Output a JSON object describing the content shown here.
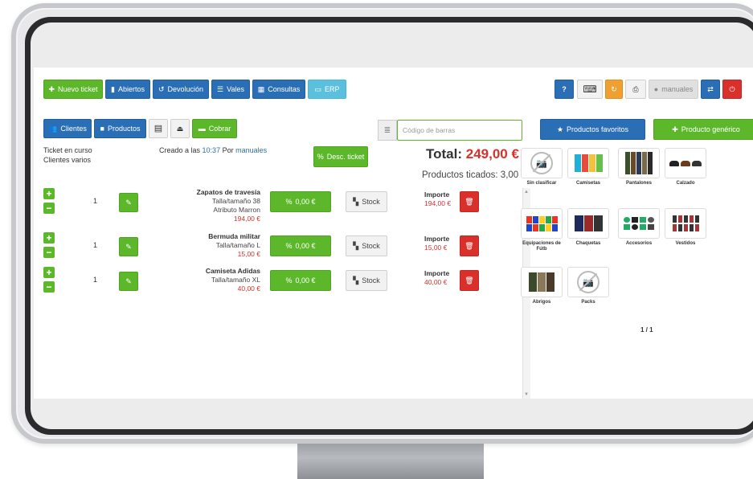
{
  "toolbar": {
    "nuevo_ticket": "Nuevo ticket",
    "abiertos": "Abiertos",
    "devolucion": "Devolución",
    "vales": "Vales",
    "consultas": "Consultas",
    "erp": "ERP",
    "user": "manuales",
    "clientes": "Clientes",
    "productos": "Productos",
    "cobrar": "Cobrar",
    "barcode_placeholder": "Código de barras",
    "productos_favoritos": "Productos favoritos",
    "producto_generico": "Producto genérico"
  },
  "ticket": {
    "status": "Ticket en curso",
    "client": "Clientes varios",
    "created_prefix": "Creado a las",
    "created_time": "10:37",
    "created_by_prefix": "Por",
    "created_by": "manuales",
    "desc_ticket": "Desc. ticket",
    "total_label": "Total:",
    "total_amount": "249,00 €",
    "productos_ticados": "Productos ticados: 3,00",
    "discount_label": "0,00 €",
    "stock_label": "Stock",
    "importe_label": "Importe",
    "lines": [
      {
        "qty": "1",
        "name": "Zapatos de travesía",
        "detail1": "Talla/tamaño 38",
        "detail2": "Atributo Marron",
        "price": "194,00 €",
        "importe": "194,00 €"
      },
      {
        "qty": "1",
        "name": "Bermuda militar",
        "detail1": "Talla/tamaño L",
        "detail2": "",
        "price": "15,00 €",
        "importe": "15,00 €"
      },
      {
        "qty": "1",
        "name": "Camiseta Adidas",
        "detail1": "Talla/tamaño XL",
        "detail2": "",
        "price": "40,00 €",
        "importe": "40,00 €"
      }
    ]
  },
  "categories": [
    {
      "label": "Sin clasificar",
      "icon": "no-image-icon"
    },
    {
      "label": "Camisetas",
      "icon": "tshirts-image"
    },
    {
      "label": "Pantalones",
      "icon": "trousers-image"
    },
    {
      "label": "Calzado",
      "icon": "shoes-image"
    },
    {
      "label": "Equipaciones de Fútb",
      "icon": "football-kits-image"
    },
    {
      "label": "Chaquetas",
      "icon": "jackets-image"
    },
    {
      "label": "Accesorios",
      "icon": "accessories-image"
    },
    {
      "label": "Vestidos",
      "icon": "dresses-image"
    },
    {
      "label": "Abrigos",
      "icon": "coats-image"
    },
    {
      "label": "Packs",
      "icon": "no-image-icon"
    }
  ],
  "pager": "1 / 1",
  "colors": {
    "green": "#5cb82a",
    "blue": "#2a6fb5",
    "lightblue": "#5bc0de",
    "orange": "#f0a030",
    "red": "#d9302c"
  }
}
